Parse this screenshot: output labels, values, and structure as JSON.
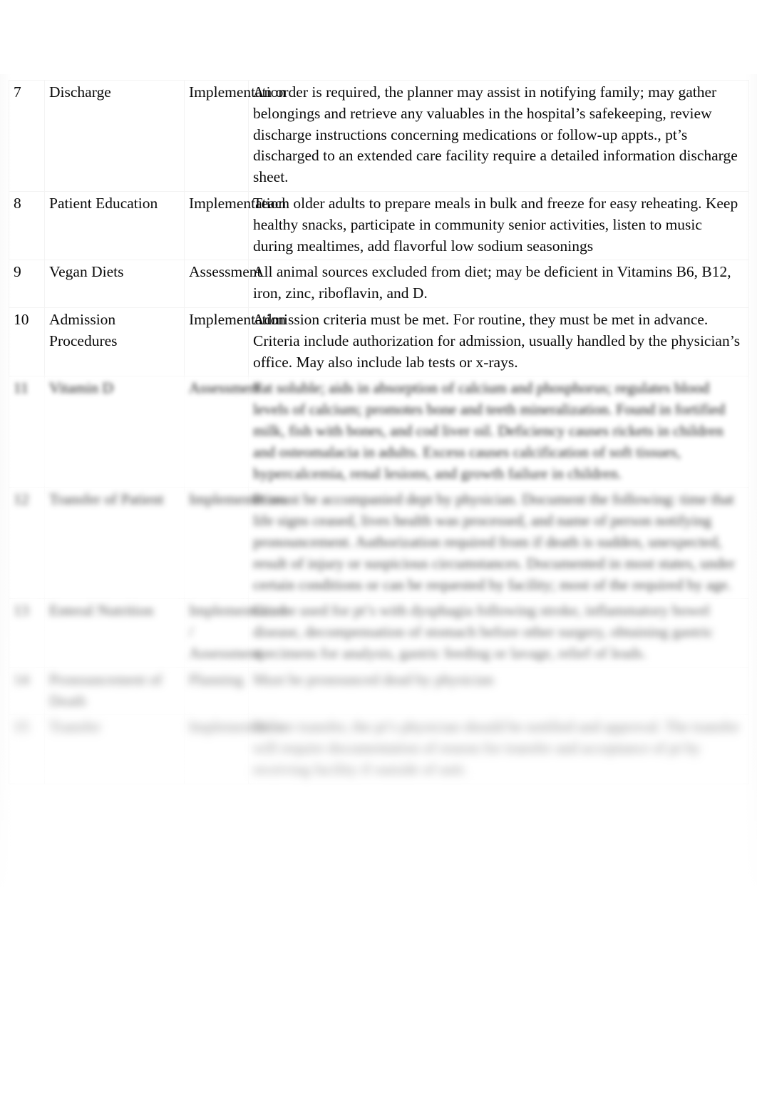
{
  "document": {
    "type": "nursing-reference-table",
    "page_background": "#ffffff",
    "text_color": "#0a0a0a",
    "gridline_color": "#f3f3f3"
  },
  "table": {
    "columns": [
      "number",
      "topic",
      "phase",
      "description"
    ],
    "rows": [
      {
        "number": "7",
        "topic": "Discharge",
        "phase": "Implementation",
        "description": "An order is required, the planner may assist in notifying family; may gather belongings and retrieve any valuables in the hospital’s safekeeping, review discharge instructions concerning medications or follow-up appts., pt’s discharged to an extended care facility require a detailed information discharge sheet.",
        "obscured": false
      },
      {
        "number": "8",
        "topic": "Patient Education",
        "phase": "Implementation",
        "description": "Teach older adults to prepare meals in bulk and freeze for easy reheating. Keep healthy snacks, participate in community senior activities, listen to music during mealtimes, add flavorful low sodium seasonings",
        "obscured": false
      },
      {
        "number": "9",
        "topic": "Vegan Diets",
        "phase": "Assessment",
        "description": "All animal sources excluded from diet; may be deficient in Vitamins B6, B12, iron, zinc, riboflavin, and D.",
        "obscured": false
      },
      {
        "number": "10",
        "topic": "Admission Procedures",
        "phase": "Implementation",
        "description": "Admission criteria must be met. For routine, they must be met in advance. Criteria include authorization for admission, usually handled by the physician’s office. May also include lab tests or x-rays.",
        "obscured": false
      },
      {
        "number": "11",
        "topic": "Vitamin D",
        "phase": "Assessment",
        "description": "Fat soluble; aids in absorption of calcium and phosphorus; regulates blood levels of calcium; promotes bone and teeth mineralization. Found in fortified milk, fish with bones, and cod liver oil. Deficiency causes rickets in children and osteomalacia in adults. Excess causes calcification of soft tissues, hypercalcemia, renal lesions, and growth failure in children.",
        "obscured": true
      },
      {
        "number": "12",
        "topic": "Transfer of Patient",
        "phase": "Implementation",
        "description": "Pt must be accompanied dept by physician. Document the following: time that life signs ceased, lives health was processed, and name of person notifying pronouncement. Authorization required from if death is sudden, unexpected, result of injury or suspicious circumstances. Documented in most states, under certain conditions or can be requested by facility; most of the required by age.",
        "obscured": true
      },
      {
        "number": "13",
        "topic": "Enteral Nutrition",
        "phase": "Implementation / Assessment",
        "description": "Can be used for pt’s with dysphagia following stroke, inflammatory bowel disease, decompensation of stomach before other surgery, obtaining gastric specimens for analysis, gastric feeding or lavage, relief of leads.",
        "obscured": true
      },
      {
        "number": "14",
        "topic": "Pronouncement of Death",
        "phase": "Planning",
        "description": "Must be pronounced dead by physician",
        "obscured": true
      },
      {
        "number": "15",
        "topic": "Transfer",
        "phase": "Implementation",
        "description": "Before transfer, the pt’s physician should be notified and approval. The transfer will require documentation of reason for transfer and acceptance of pt by receiving facility if outside of unit.",
        "obscured": true
      }
    ]
  }
}
